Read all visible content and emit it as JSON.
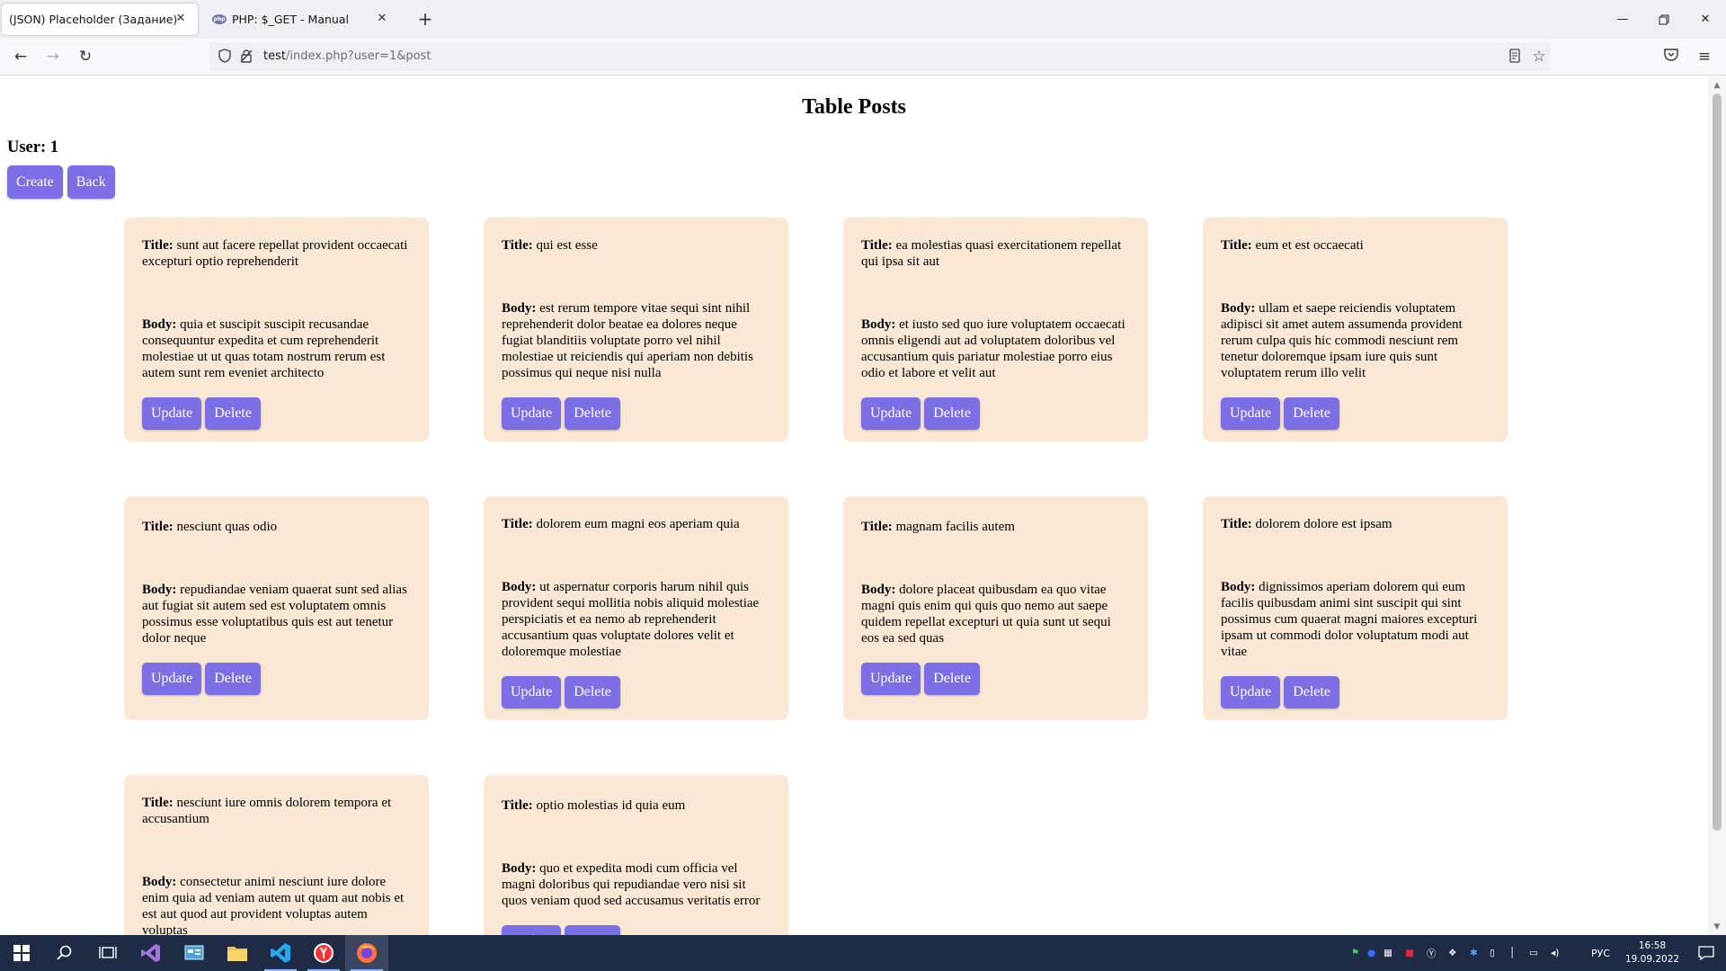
{
  "browser": {
    "tabs": [
      {
        "label": "(JSON) Placeholder (Задание)",
        "active": true,
        "close_label": "✕"
      },
      {
        "label": "PHP: $_GET - Manual",
        "active": false,
        "favicon": "php",
        "close_label": "✕"
      }
    ],
    "new_tab_label": "+",
    "url_host": "test",
    "url_rest": "/index.php?user=1&post"
  },
  "page": {
    "heading": "Table Posts",
    "user_label": "User: 1",
    "create_label": "Create",
    "back_label": "Back",
    "title_prefix": "Title:",
    "body_prefix": "Body:",
    "update_label": "Update",
    "delete_label": "Delete",
    "accent_color": "#7b6fe6",
    "card_color": "#fae8d4",
    "posts": [
      {
        "title": "sunt aut facere repellat provident occaecati excepturi optio reprehenderit",
        "body": "quia et suscipit suscipit recusandae consequuntur expedita et cum reprehenderit molestiae ut ut quas totam nostrum rerum est autem sunt rem eveniet architecto"
      },
      {
        "title": "qui est esse",
        "body": "est rerum tempore vitae sequi sint nihil reprehenderit dolor beatae ea dolores neque fugiat blanditiis voluptate porro vel nihil molestiae ut reiciendis qui aperiam non debitis possimus qui neque nisi nulla"
      },
      {
        "title": "ea molestias quasi exercitationem repellat qui ipsa sit aut",
        "body": "et iusto sed quo iure voluptatem occaecati omnis eligendi aut ad voluptatem doloribus vel accusantium quis pariatur molestiae porro eius odio et labore et velit aut"
      },
      {
        "title": "eum et est occaecati",
        "body": "ullam et saepe reiciendis voluptatem adipisci sit amet autem assumenda provident rerum culpa quis hic commodi nesciunt rem tenetur doloremque ipsam iure quis sunt voluptatem rerum illo velit"
      },
      {
        "title": "nesciunt quas odio",
        "body": "repudiandae veniam quaerat sunt sed alias aut fugiat sit autem sed est voluptatem omnis possimus esse voluptatibus quis est aut tenetur dolor neque"
      },
      {
        "title": "dolorem eum magni eos aperiam quia",
        "body": "ut aspernatur corporis harum nihil quis provident sequi mollitia nobis aliquid molestiae perspiciatis et ea nemo ab reprehenderit accusantium quas voluptate dolores velit et doloremque molestiae"
      },
      {
        "title": "magnam facilis autem",
        "body": "dolore placeat quibusdam ea quo vitae magni quis enim qui quis quo nemo aut saepe quidem repellat excepturi ut quia sunt ut sequi eos ea sed quas"
      },
      {
        "title": "dolorem dolore est ipsam",
        "body": "dignissimos aperiam dolorem qui eum facilis quibusdam animi sint suscipit qui sint possimus cum quaerat magni maiores excepturi ipsam ut commodi dolor voluptatum modi aut vitae"
      },
      {
        "title": "nesciunt iure omnis dolorem tempora et accusantium",
        "body": "consectetur animi nesciunt iure dolore enim quia ad veniam autem ut quam aut nobis et est aut quod aut provident voluptas autem voluptas"
      },
      {
        "title": "optio molestias id quia eum",
        "body": "quo et expedita modi cum officia vel magni doloribus qui repudiandae vero nisi sit quos veniam quod sed accusamus veritatis error"
      }
    ]
  },
  "taskbar": {
    "apps": [
      "windows-start-icon",
      "search-icon",
      "task-view-icon",
      "visual-studio-icon",
      "control-panel-icon",
      "file-explorer-icon",
      "vscode-icon",
      "yandex-browser-icon",
      "firefox-icon"
    ],
    "language": "РУС",
    "time": "16:58",
    "date": "19.09.2022"
  }
}
